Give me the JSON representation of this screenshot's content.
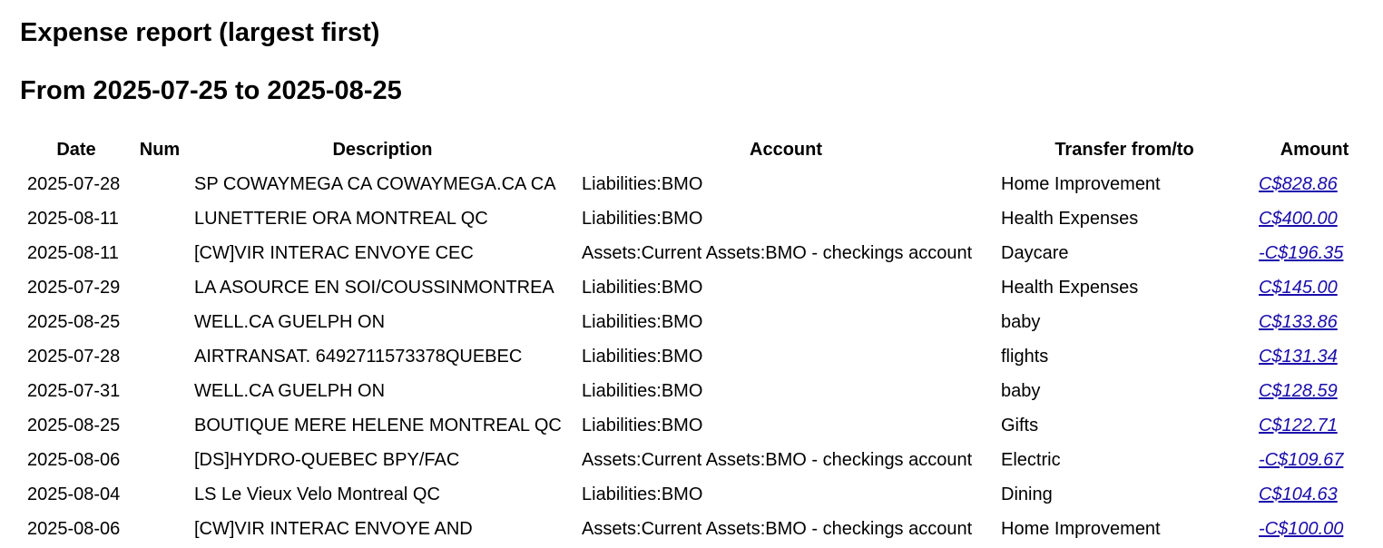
{
  "report": {
    "title": "Expense report (largest first)",
    "range": "From 2025-07-25 to 2025-08-25"
  },
  "table": {
    "headers": {
      "date": "Date",
      "num": "Num",
      "description": "Description",
      "account": "Account",
      "transfer": "Transfer from/to",
      "amount": "Amount"
    },
    "rows": [
      {
        "date": "2025-07-28",
        "num": "",
        "description": "SP COWAYMEGA CA COWAYMEGA.CA CA",
        "account": "Liabilities:BMO",
        "transfer": "Home Improvement",
        "amount": "C$828.86"
      },
      {
        "date": "2025-08-11",
        "num": "",
        "description": "LUNETTERIE ORA MONTREAL QC",
        "account": "Liabilities:BMO",
        "transfer": "Health Expenses",
        "amount": "C$400.00"
      },
      {
        "date": "2025-08-11",
        "num": "",
        "description": "[CW]VIR INTERAC ENVOYE CEC",
        "account": "Assets:Current Assets:BMO - checkings account",
        "transfer": "Daycare",
        "amount": "-C$196.35"
      },
      {
        "date": "2025-07-29",
        "num": "",
        "description": "LA ASOURCE EN SOI/COUSSINMONTREA",
        "account": "Liabilities:BMO",
        "transfer": "Health Expenses",
        "amount": "C$145.00"
      },
      {
        "date": "2025-08-25",
        "num": "",
        "description": "WELL.CA GUELPH ON",
        "account": "Liabilities:BMO",
        "transfer": "baby",
        "amount": "C$133.86"
      },
      {
        "date": "2025-07-28",
        "num": "",
        "description": "AIRTRANSAT. 6492711573378QUEBEC",
        "account": "Liabilities:BMO",
        "transfer": "flights",
        "amount": "C$131.34"
      },
      {
        "date": "2025-07-31",
        "num": "",
        "description": "WELL.CA GUELPH ON",
        "account": "Liabilities:BMO",
        "transfer": "baby",
        "amount": "C$128.59"
      },
      {
        "date": "2025-08-25",
        "num": "",
        "description": "BOUTIQUE MERE HELENE MONTREAL QC",
        "account": "Liabilities:BMO",
        "transfer": "Gifts",
        "amount": "C$122.71"
      },
      {
        "date": "2025-08-06",
        "num": "",
        "description": "[DS]HYDRO-QUEBEC BPY/FAC",
        "account": "Assets:Current Assets:BMO - checkings account",
        "transfer": "Electric",
        "amount": "-C$109.67"
      },
      {
        "date": "2025-08-04",
        "num": "",
        "description": "LS Le Vieux Velo Montreal QC",
        "account": "Liabilities:BMO",
        "transfer": "Dining",
        "amount": "C$104.63"
      },
      {
        "date": "2025-08-06",
        "num": "",
        "description": "[CW]VIR INTERAC ENVOYE AND",
        "account": "Assets:Current Assets:BMO - checkings account",
        "transfer": "Home Improvement",
        "amount": "-C$100.00"
      }
    ]
  },
  "colors": {
    "link": "#1a0dab",
    "text": "#000000",
    "background": "#ffffff"
  }
}
